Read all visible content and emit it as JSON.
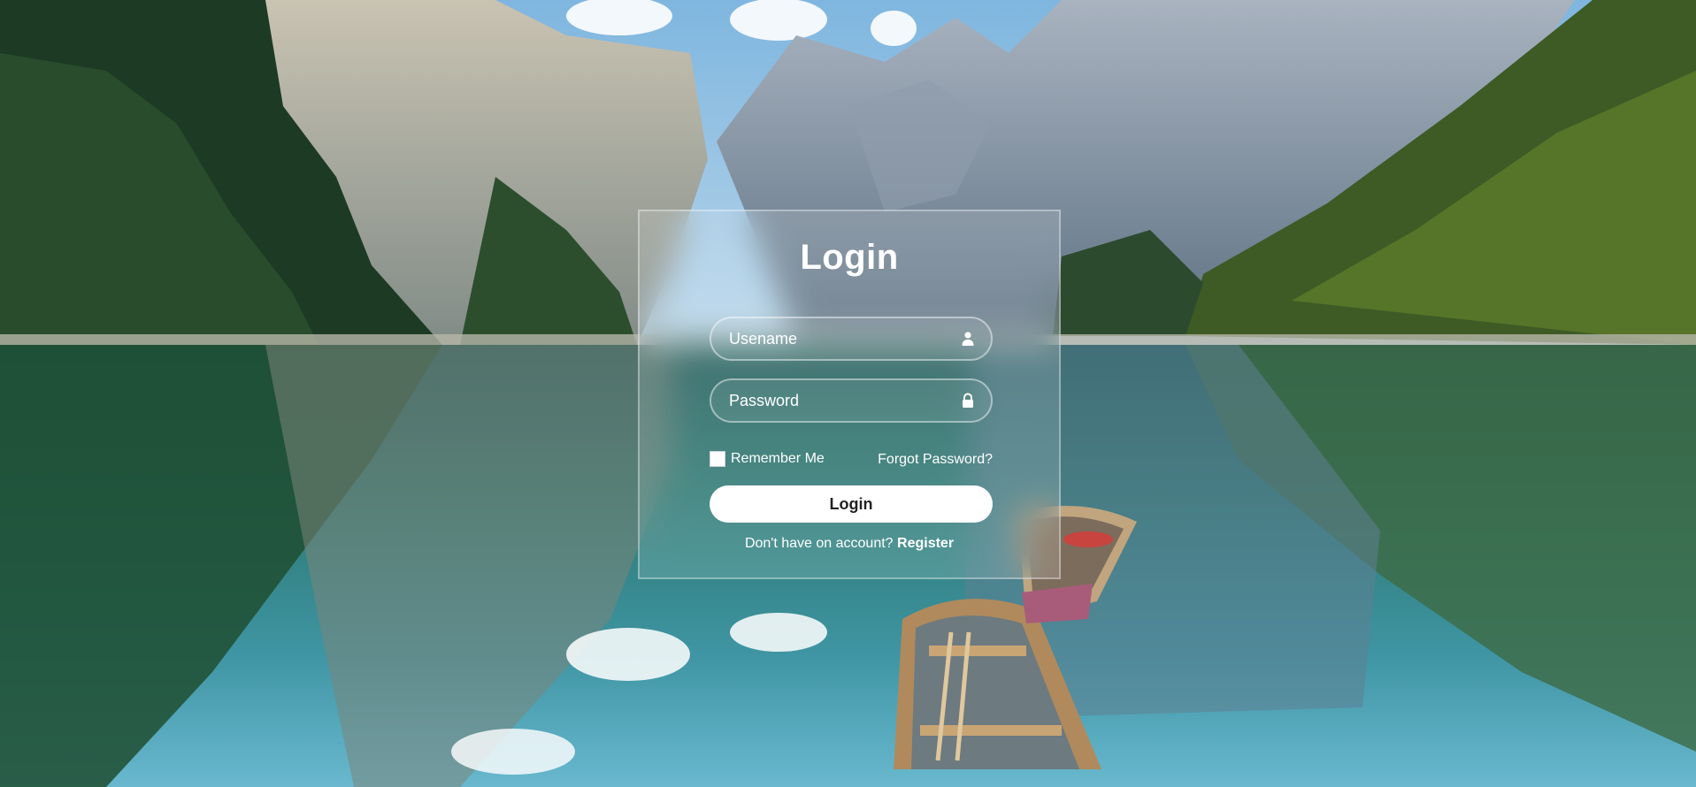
{
  "background": {
    "description_icon": "mountain-lake-photo-icon"
  },
  "login": {
    "title": "Login",
    "username_placeholder": "Usename",
    "username_value": "",
    "password_placeholder": "Password",
    "password_value": "",
    "remember_label": "Remember Me",
    "remember_checked": false,
    "forgot_label": "Forgot Password?",
    "button_label": "Login",
    "register_prompt": "Don't have on account?",
    "register_label": "Register",
    "icons": {
      "username": "user-icon",
      "password": "lock-icon"
    }
  },
  "colors": {
    "card_tint": "#ffffff",
    "button_bg": "#ffffff",
    "button_text": "#222222"
  }
}
